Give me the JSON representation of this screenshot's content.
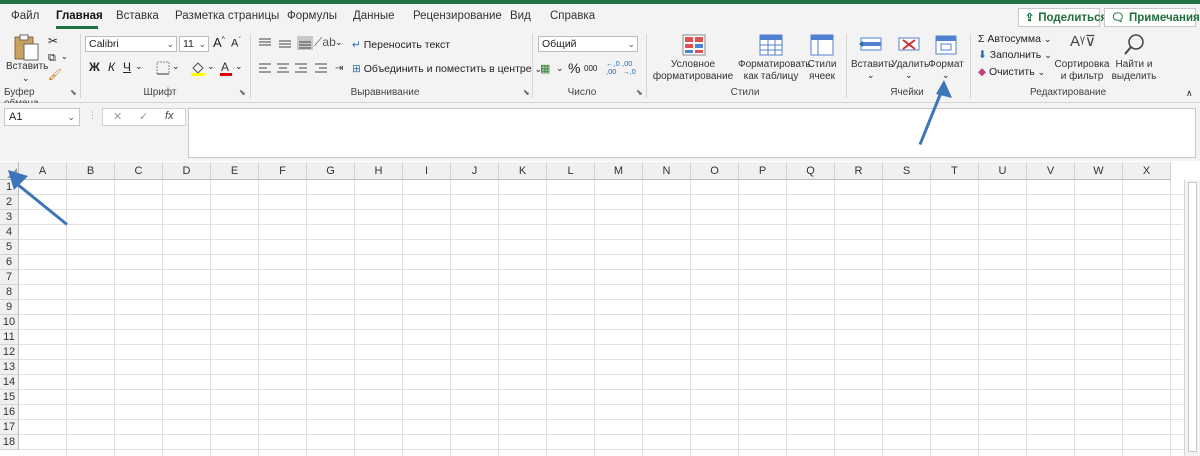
{
  "menu_tabs": [
    "Файл",
    "Главная",
    "Вставка",
    "Разметка страницы",
    "Формулы",
    "Данные",
    "Рецензирование",
    "Вид",
    "Справка"
  ],
  "share_label": "Поделиться",
  "notes_label": "Примечания",
  "clipboard": {
    "paste": "Вставить",
    "group": "Буфер обмена"
  },
  "font": {
    "name": "Calibri",
    "size": "11",
    "bold": "Ж",
    "italic": "К",
    "underline": "Ч",
    "grow": "A",
    "shrink": "A",
    "group": "Шрифт"
  },
  "alignment": {
    "wrap": "Переносить текст",
    "merge": "Объединить и поместить в центре",
    "group": "Выравнивание"
  },
  "number": {
    "format": "Общий",
    "percent": "%",
    "thousands": "000",
    "inc_decimal": "←,0\n,00",
    "dec_decimal": ",00\n→,0",
    "group": "Число"
  },
  "styles": {
    "conditional": "Условное\nформатирование",
    "as_table": "Форматировать\nкак таблицу",
    "cell_styles": "Стили\nячеек",
    "group": "Стили"
  },
  "cells": {
    "insert": "Вставить",
    "delete": "Удалить",
    "format": "Формат",
    "group": "Ячейки"
  },
  "editing": {
    "autosum": "Автосумма",
    "fill": "Заполнить",
    "clear": "Очистить",
    "sort": "Сортировка\nи фильтр",
    "find": "Найти и\nвыделить",
    "group": "Редактирование"
  },
  "formula_bar": {
    "name_box": "A1",
    "cancel": "✕",
    "enter": "✓",
    "fx": "fx",
    "value": ""
  },
  "columns": [
    "A",
    "B",
    "C",
    "D",
    "E",
    "F",
    "G",
    "H",
    "I",
    "J",
    "K",
    "L",
    "M",
    "N",
    "O",
    "P",
    "Q",
    "R",
    "S",
    "T",
    "U",
    "V",
    "W",
    "X"
  ],
  "rows": [
    "1",
    "2",
    "3",
    "4",
    "5",
    "6",
    "7",
    "8",
    "9",
    "10",
    "11",
    "12",
    "13",
    "14",
    "15",
    "16",
    "17",
    "18"
  ],
  "colors": {
    "accent": "#217346",
    "annotation_arrow": "#3d76b8"
  }
}
